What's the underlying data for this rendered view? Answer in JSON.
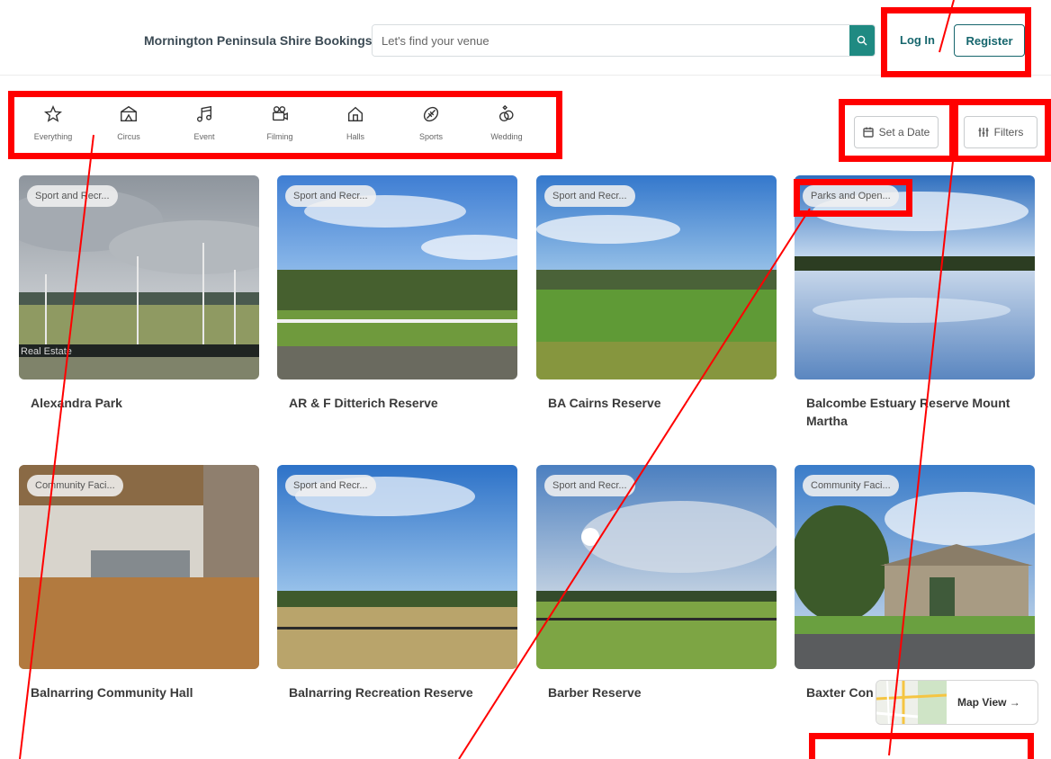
{
  "header": {
    "brand": "Mornington Peninsula Shire Bookings",
    "search_placeholder": "Let's find your venue",
    "login_label": "Log In",
    "register_label": "Register"
  },
  "categories": [
    {
      "label": "Everything",
      "icon": "star-icon"
    },
    {
      "label": "Circus",
      "icon": "tent-icon"
    },
    {
      "label": "Event",
      "icon": "music-icon"
    },
    {
      "label": "Filming",
      "icon": "camera-icon"
    },
    {
      "label": "Halls",
      "icon": "house-icon"
    },
    {
      "label": "Sports",
      "icon": "ball-icon"
    },
    {
      "label": "Wedding",
      "icon": "rings-icon"
    }
  ],
  "actions": {
    "set_date_label": "Set a Date",
    "filters_label": "Filters"
  },
  "venues": [
    {
      "name": "Alexandra Park",
      "badge": "Sport and Recr..."
    },
    {
      "name": "AR & F Ditterich Reserve",
      "badge": "Sport and Recr..."
    },
    {
      "name": "BA Cairns Reserve",
      "badge": "Sport and Recr..."
    },
    {
      "name": "Balcombe Estuary Reserve Mount Martha",
      "badge": "Parks and Open..."
    },
    {
      "name": "Balnarring Community Hall",
      "badge": "Community Faci..."
    },
    {
      "name": "Balnarring Recreation Reserve",
      "badge": "Sport and Recr..."
    },
    {
      "name": "Barber Reserve",
      "badge": "Sport and Recr..."
    },
    {
      "name": "Baxter Con",
      "badge": "Community Faci..."
    }
  ],
  "photo_text": {
    "signage": "Real Estate"
  },
  "map_view": {
    "label": "Map View →"
  },
  "colors": {
    "accent": "#1f8a82",
    "brand_text": "#16666d",
    "annotation": "#ff0000"
  }
}
